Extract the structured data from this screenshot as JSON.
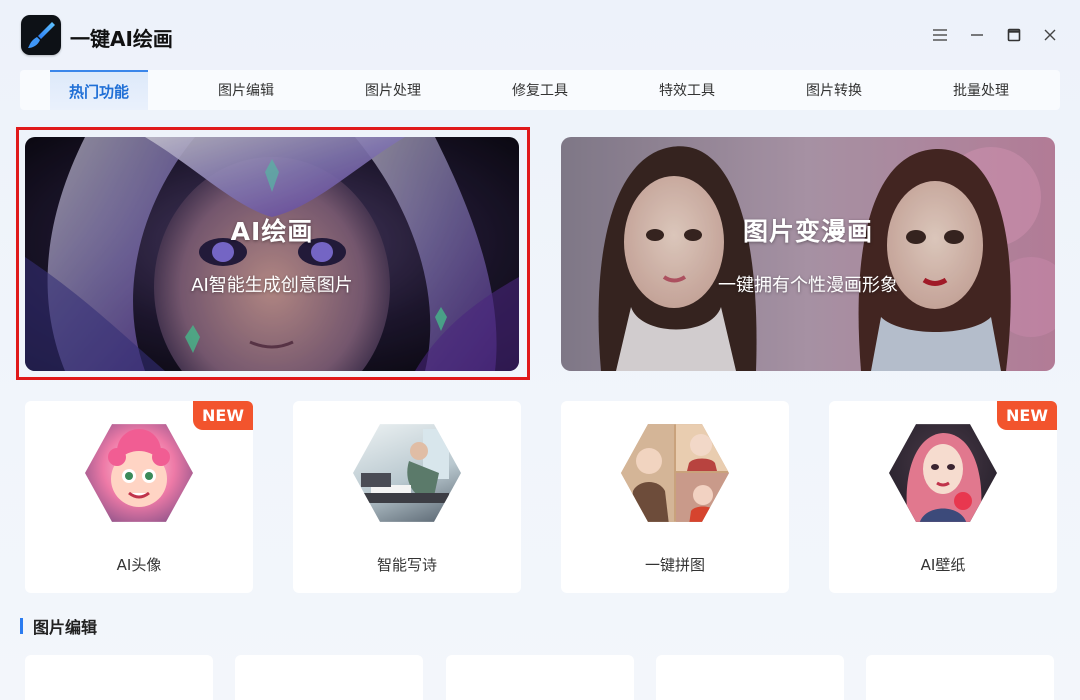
{
  "app": {
    "title": "一键AI绘画",
    "logo_icon": "paintbrush-icon"
  },
  "window_controls": {
    "menu_icon": "hamburger-menu-icon",
    "minimize_icon": "minimize-icon",
    "maximize_icon": "maximize-icon",
    "close_icon": "close-icon"
  },
  "tabs": [
    {
      "label": "热门功能",
      "active": true
    },
    {
      "label": "图片编辑",
      "active": false
    },
    {
      "label": "图片处理",
      "active": false
    },
    {
      "label": "修复工具",
      "active": false
    },
    {
      "label": "特效工具",
      "active": false
    },
    {
      "label": "图片转换",
      "active": false
    },
    {
      "label": "批量处理",
      "active": false
    }
  ],
  "banners": [
    {
      "title": "AI绘画",
      "subtitle": "AI智能生成创意图片",
      "highlighted": true
    },
    {
      "title": "图片变漫画",
      "subtitle": "一键拥有个性漫画形象",
      "highlighted": false
    }
  ],
  "feature_cards": [
    {
      "label": "AI头像",
      "badge": "NEW",
      "image": "cartoon-avatar-icon"
    },
    {
      "label": "智能写诗",
      "badge": "",
      "image": "poet-writing-icon"
    },
    {
      "label": "一键拼图",
      "badge": "",
      "image": "photo-collage-icon"
    },
    {
      "label": "AI壁纸",
      "badge": "NEW",
      "image": "portrait-wallpaper-icon"
    }
  ],
  "sections": [
    {
      "title": "图片编辑"
    }
  ],
  "colors": {
    "accent": "#2b7cf0",
    "active_tab_text": "#1f6fd6",
    "badge": "#f2542d",
    "highlight_frame": "#e0191a"
  }
}
